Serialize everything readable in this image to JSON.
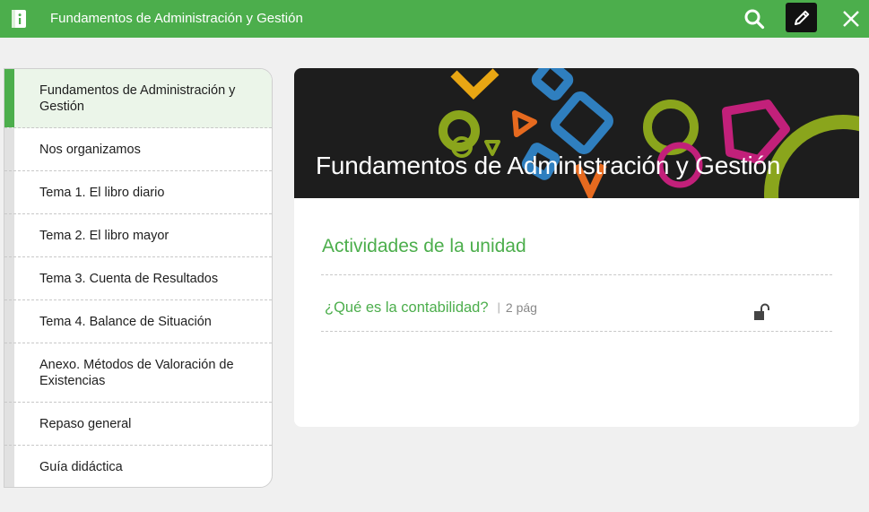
{
  "header": {
    "title": "Fundamentos de Administración y Gestión",
    "icons": {
      "app": "book-icon",
      "search": "search-icon",
      "edit": "pencil-icon",
      "close": "close-icon"
    },
    "accent": "#4cae4c"
  },
  "sidebar": {
    "items": [
      {
        "label": "Fundamentos de Administración y Gestión",
        "active": true
      },
      {
        "label": "Nos organizamos"
      },
      {
        "label": "Tema 1. El libro diario"
      },
      {
        "label": "Tema 2. El libro mayor"
      },
      {
        "label": "Tema 3. Cuenta de Resultados"
      },
      {
        "label": "Tema 4. Balance de Situación"
      },
      {
        "label": "Anexo. Métodos de Valoración de Existencias"
      },
      {
        "label": "Repaso general"
      },
      {
        "label": "Guía didáctica"
      }
    ]
  },
  "main": {
    "banner_title": "Fundamentos de Administración y Gestión",
    "section_title": "Actividades de la unidad",
    "activities": [
      {
        "title": "¿Qué es la contabilidad?",
        "separator": "|",
        "pages": "2 pág",
        "icon": "unlock-icon"
      }
    ]
  }
}
